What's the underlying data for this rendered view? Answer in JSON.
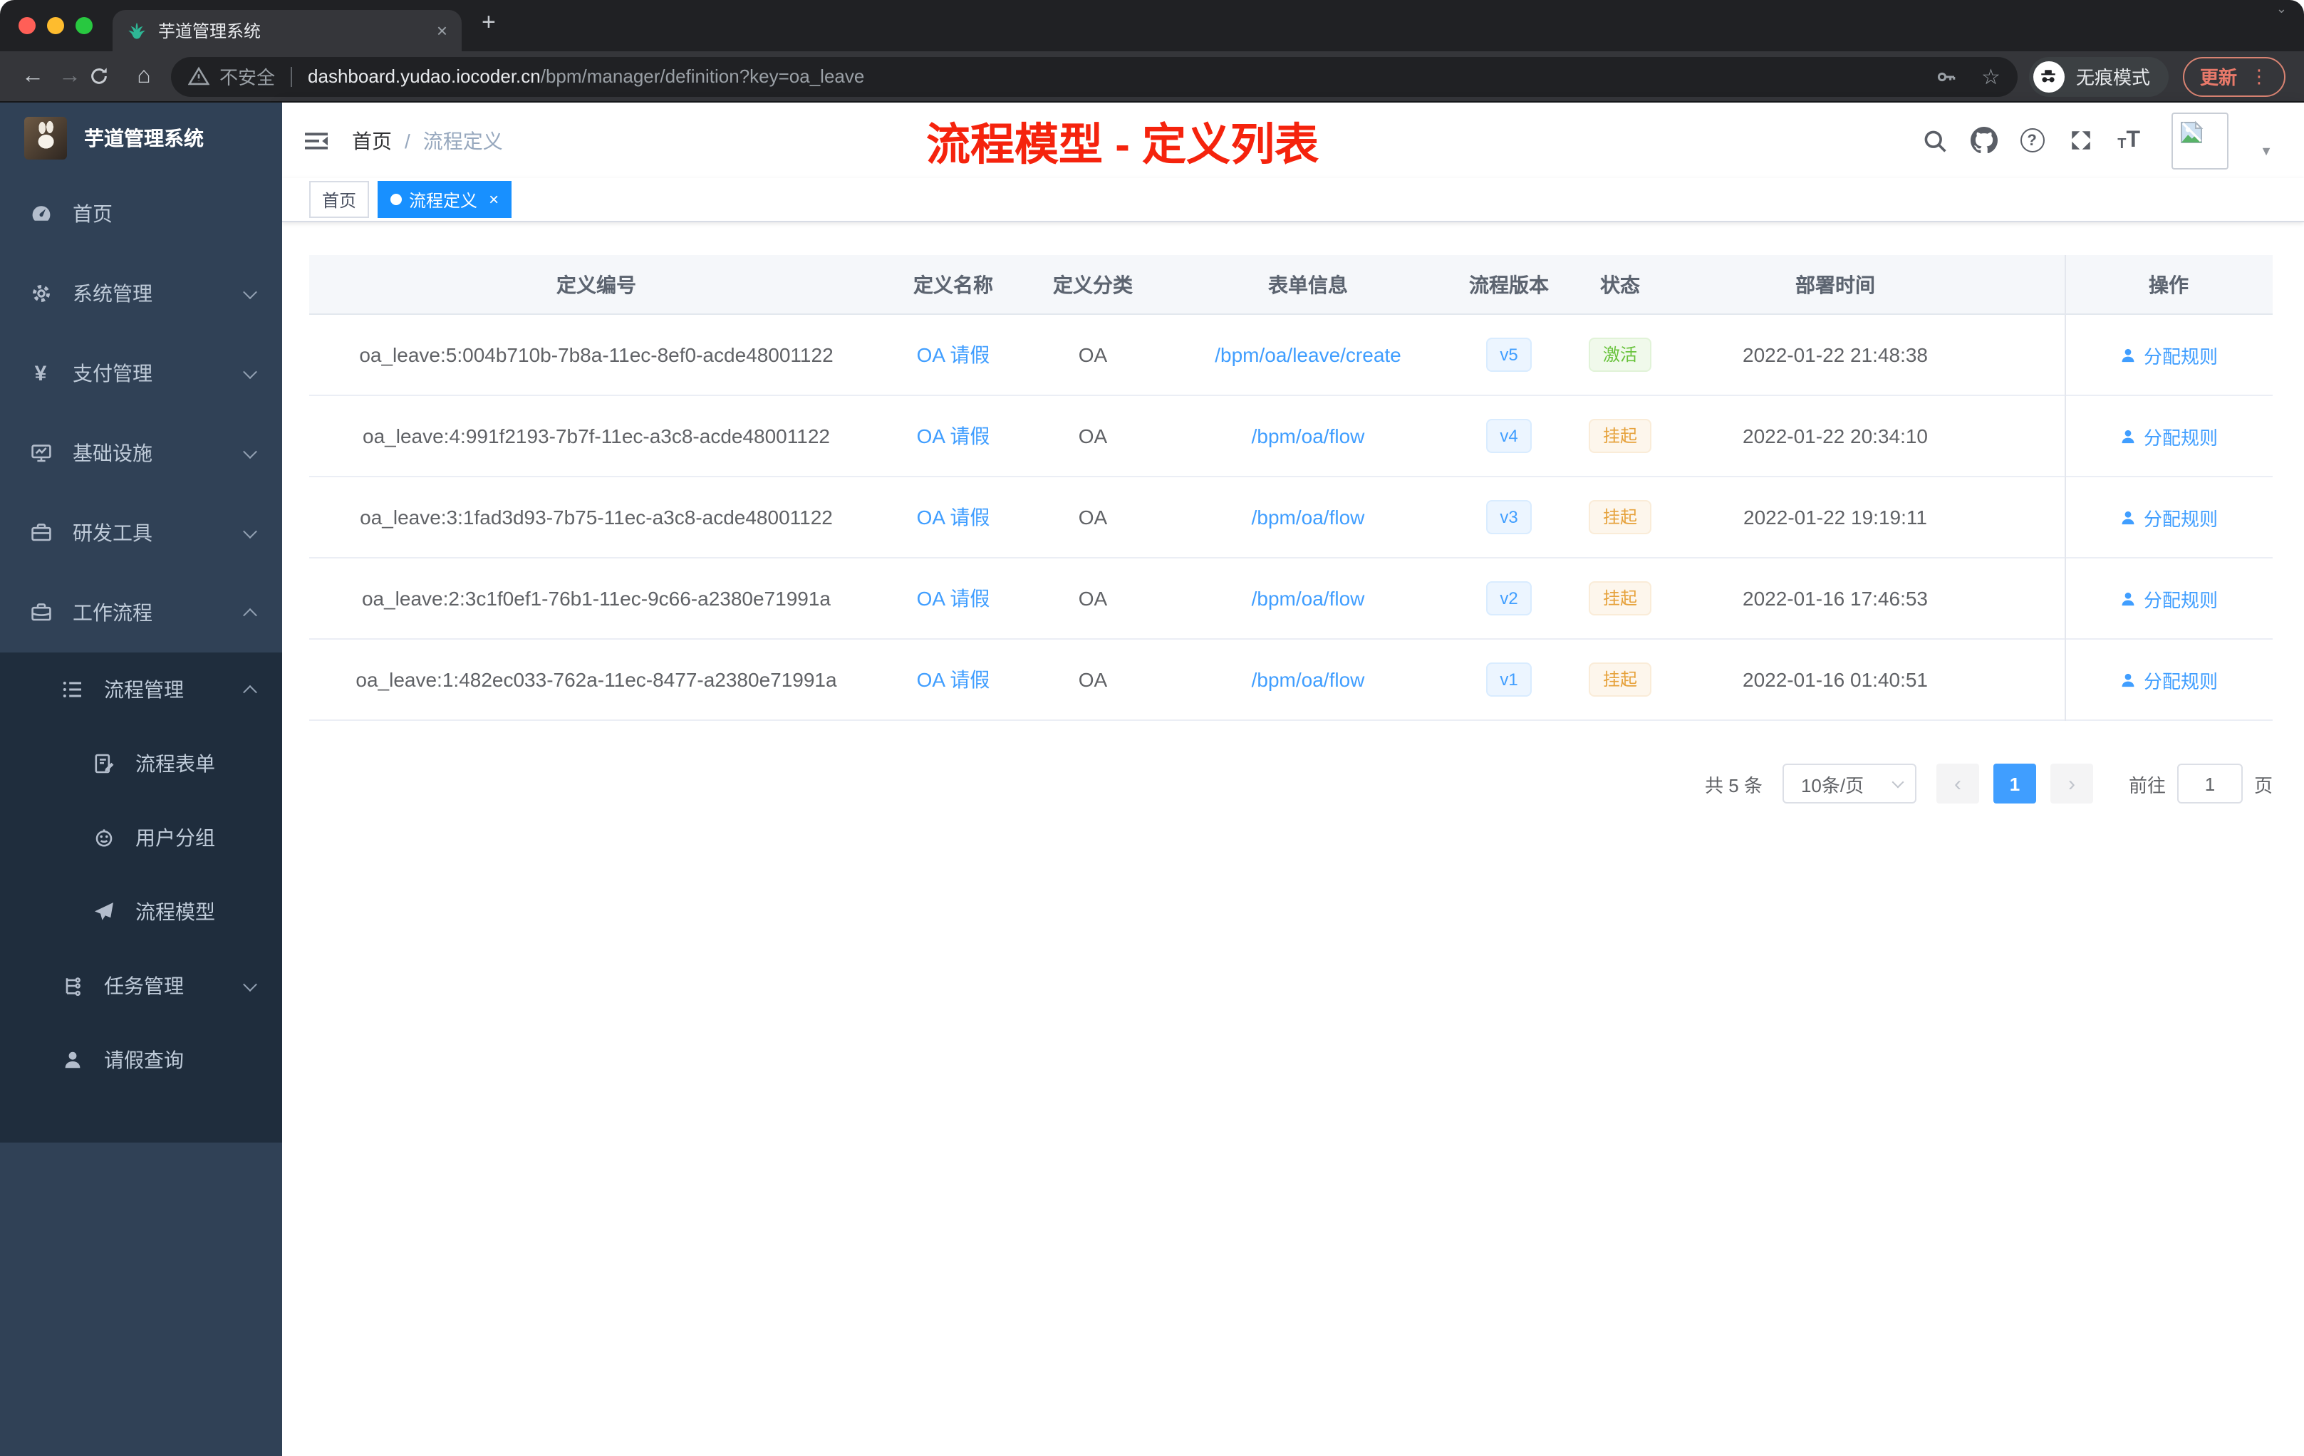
{
  "browser": {
    "tab": {
      "title": "芋道管理系统",
      "close_glyph": "×",
      "new_tab_glyph": "+",
      "corner_glyph": "⌄"
    },
    "toolbar": {
      "back_glyph": "←",
      "forward_glyph": "→",
      "home_glyph": "⌂",
      "security_label": "不安全",
      "url_host": "dashboard.yudao.iocoder.cn",
      "url_path": "/bpm/manager/definition?key=oa_leave",
      "star_glyph": "☆",
      "incognito_label": "无痕模式",
      "update_label": "更新",
      "menu_dots_glyph": "⋮"
    }
  },
  "sidebar": {
    "logo_title": "芋道管理系统",
    "menu": [
      {
        "label": "首页"
      },
      {
        "label": "系统管理"
      },
      {
        "label": "支付管理"
      },
      {
        "label": "基础设施"
      },
      {
        "label": "研发工具"
      },
      {
        "label": "工作流程"
      },
      {
        "label": "流程管理"
      },
      {
        "label": "流程表单"
      },
      {
        "label": "用户分组"
      },
      {
        "label": "流程模型"
      },
      {
        "label": "任务管理"
      },
      {
        "label": "请假查询"
      }
    ],
    "yen_glyph": "¥"
  },
  "navbar": {
    "breadcrumb_home": "首页",
    "breadcrumb_separator": "/",
    "breadcrumb_current": "流程定义",
    "question_glyph": "?",
    "font_small_glyph": "T",
    "font_big_glyph": "T",
    "avatar_caret_glyph": "▼"
  },
  "annotation": "流程模型 - 定义列表",
  "tags": [
    {
      "label": "首页"
    },
    {
      "label": "流程定义",
      "close_glyph": "×"
    }
  ],
  "table": {
    "columns": [
      "定义编号",
      "定义名称",
      "定义分类",
      "表单信息",
      "流程版本",
      "状态",
      "部署时间",
      "操作"
    ],
    "rows": [
      {
        "id": "oa_leave:5:004b710b-7b8a-11ec-8ef0-acde48001122",
        "name": "OA 请假",
        "category": "OA",
        "form": "/bpm/oa/leave/create",
        "version": "v5",
        "status": "激活",
        "deploy_time": "2022-01-22 21:48:38",
        "action": "分配规则"
      },
      {
        "id": "oa_leave:4:991f2193-7b7f-11ec-a3c8-acde48001122",
        "name": "OA 请假",
        "category": "OA",
        "form": "/bpm/oa/flow",
        "version": "v4",
        "status": "挂起",
        "deploy_time": "2022-01-22 20:34:10",
        "action": "分配规则"
      },
      {
        "id": "oa_leave:3:1fad3d93-7b75-11ec-a3c8-acde48001122",
        "name": "OA 请假",
        "category": "OA",
        "form": "/bpm/oa/flow",
        "version": "v3",
        "status": "挂起",
        "deploy_time": "2022-01-22 19:19:11",
        "action": "分配规则"
      },
      {
        "id": "oa_leave:2:3c1f0ef1-76b1-11ec-9c66-a2380e71991a",
        "name": "OA 请假",
        "category": "OA",
        "form": "/bpm/oa/flow",
        "version": "v2",
        "status": "挂起",
        "deploy_time": "2022-01-16 17:46:53",
        "action": "分配规则"
      },
      {
        "id": "oa_leave:1:482ec033-762a-11ec-8477-a2380e71991a",
        "name": "OA 请假",
        "category": "OA",
        "form": "/bpm/oa/flow",
        "version": "v1",
        "status": "挂起",
        "deploy_time": "2022-01-16 01:40:51",
        "action": "分配规则"
      }
    ]
  },
  "pagination": {
    "total": "共 5 条",
    "page_size": "10条/页",
    "prev_glyph": "‹",
    "page": "1",
    "next_glyph": "›",
    "goto_label": "前往",
    "goto_value": "1",
    "goto_suffix": "页"
  },
  "icons": {
    "tab_favicon": "leaf-logo",
    "omnibox_security": "warning-triangle",
    "omnibox_right": [
      "key",
      "star"
    ],
    "incognito_badge": "incognito-hat-glasses",
    "navbar_left": "hamburger-fold",
    "navbar_right": [
      "search",
      "github",
      "question",
      "fullscreen",
      "font-size",
      "broken-image-avatar",
      "caret-down"
    ],
    "sidebar": [
      "dashboard",
      "gear",
      "yen",
      "monitor-chart",
      "toolbox",
      "briefcase",
      "ordered-list",
      "form-edit",
      "robot-face",
      "paper-plane",
      "org-tree",
      "person"
    ],
    "table_action": "person"
  },
  "colors": {
    "accent": "#409eff",
    "tag_active": "#1890ff",
    "annotation_red": "#f5230d",
    "status_active": "#67c23a",
    "status_suspended": "#e6a23c",
    "sidebar_bg": "#304156",
    "sidebar_submenu_bg": "#1f2d3d",
    "chrome_frame": "#202124",
    "chrome_tab": "#35363a",
    "update_button": "#e8796a"
  }
}
